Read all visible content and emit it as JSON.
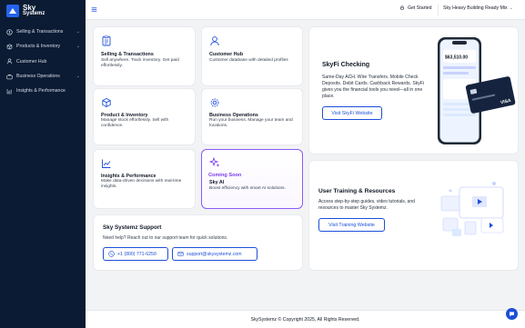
{
  "brand": {
    "line1": "Sky",
    "line2": "Systemz",
    "color": "#2563eb"
  },
  "sidebar": {
    "items": [
      {
        "label": "Selling & Transactions",
        "icon": "dollar-circle-icon",
        "has_chevron": true
      },
      {
        "label": "Products & Inventory",
        "icon": "box-icon",
        "has_chevron": true
      },
      {
        "label": "Customer Hub",
        "icon": "user-icon",
        "has_chevron": false
      },
      {
        "label": "Business Operations",
        "icon": "briefcase-icon",
        "has_chevron": true
      },
      {
        "label": "Insights & Performance",
        "icon": "chart-icon",
        "has_chevron": false
      }
    ]
  },
  "topbar": {
    "get_started": "Get Started",
    "company": "Sky Heavy Building Ready Mix"
  },
  "features": [
    {
      "title": "Selling & Transactions",
      "desc": "Sell anywhere. Track inventory. Get paid effortlessly.",
      "icon": "clipboard-icon"
    },
    {
      "title": "Customer Hub",
      "desc": "Customer database with detailed profiles",
      "icon": "user-icon"
    },
    {
      "title": "Product & Inventory",
      "desc": "Manage stock effortlessly. Sell with confidence.",
      "icon": "box-icon"
    },
    {
      "title": "Business Operations",
      "desc": "Run your business. Manage your team and locations.",
      "icon": "gear-icon"
    },
    {
      "title": "Insights & Performance",
      "desc": "Make data-driven decisions with real-time insights.",
      "icon": "chart-icon"
    }
  ],
  "ai_card": {
    "badge": "Coming Soon",
    "title": "Sky AI",
    "desc": "Boost efficiency with smart AI solutions.",
    "icon": "sparkle-icon",
    "accent": "#7c3aed"
  },
  "support": {
    "title": "Sky Systemz Support",
    "desc": "Need help? Reach out to our support team for quick solutions.",
    "phone": "+1 (800) 771-6250",
    "email": "support@skysystemz.com"
  },
  "skyfi": {
    "title": "SkyFi Checking",
    "desc": "Same-Day ACH. Wire Transfers. Mobile Check Deposits. Debit Cards. Cashback Rewards. SkyFi gives you the financial tools you need—all in one place.",
    "button": "Visit SkyFi Website",
    "phone_balance": "$63,510.00",
    "card_brand": "VISA"
  },
  "training": {
    "title": "User Training & Resources",
    "desc": "Access step-by-step guides, video tutorials, and resources to master Sky Systemz.",
    "button": "Visit Training Website"
  },
  "footer": {
    "text": "SkySystemz © Copyright 2025, All Rights Reserved."
  },
  "colors": {
    "sidebar_bg": "#0b1b33",
    "primary": "#1d4ed8",
    "page_bg": "#f2f3f5"
  }
}
